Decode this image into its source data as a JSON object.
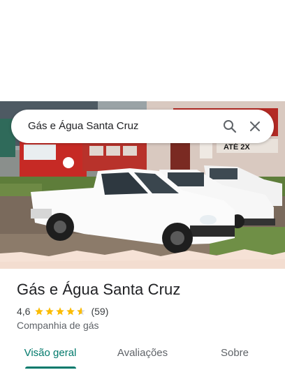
{
  "search": {
    "query": "Gás e Água Santa Cruz"
  },
  "place": {
    "name": "Gás e Água Santa Cruz",
    "rating": "4,6",
    "rating_value": 4.6,
    "reviews_count": "(59)",
    "category": "Companhia de gás"
  },
  "photo": {
    "sign_text": "ATÉ 2X"
  },
  "tabs": [
    {
      "label": "Visão geral",
      "selected": true
    },
    {
      "label": "Avaliações",
      "selected": false
    },
    {
      "label": "Sobre",
      "selected": false
    }
  ],
  "colors": {
    "accent": "#00796b",
    "star": "#fbbc04",
    "star_empty": "#dadce0"
  },
  "icons": {
    "search": "search-icon",
    "close": "close-icon",
    "star": "star-icon"
  }
}
